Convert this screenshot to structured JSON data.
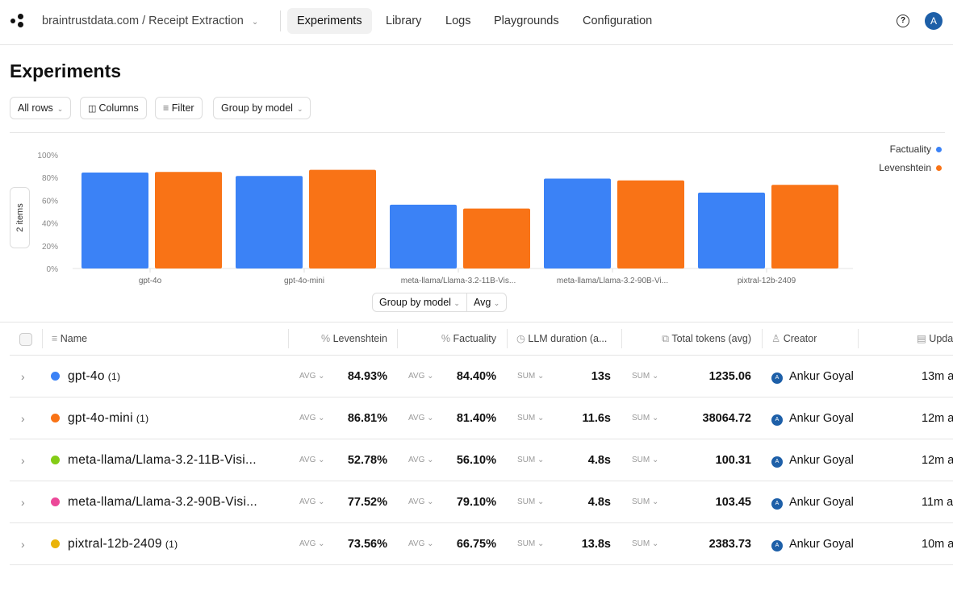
{
  "header": {
    "project": "braintrustdata.com / Receipt Extraction",
    "nav": [
      "Experiments",
      "Library",
      "Logs",
      "Playgrounds",
      "Configuration"
    ],
    "active_nav": "Experiments",
    "avatar": "A"
  },
  "page": {
    "title": "Experiments"
  },
  "toolbar": {
    "all_rows": "All rows",
    "columns": "Columns",
    "filter": "Filter",
    "group_by": "Group by model"
  },
  "chart_controls": {
    "items": "2 items",
    "group_by": "Group by model",
    "agg": "Avg"
  },
  "chart_data": {
    "type": "bar",
    "categories": [
      "gpt-4o",
      "gpt-4o-mini",
      "meta-llama/Llama-3.2-11B-Vis...",
      "meta-llama/Llama-3.2-90B-Vi...",
      "pixtral-12b-2409"
    ],
    "series": [
      {
        "name": "Factuality",
        "color": "#3b82f6",
        "values": [
          84.4,
          81.4,
          56.1,
          79.1,
          66.75
        ]
      },
      {
        "name": "Levenshtein",
        "color": "#f97316",
        "values": [
          84.93,
          86.81,
          52.78,
          77.52,
          73.56
        ]
      }
    ],
    "ylim": [
      0,
      100
    ],
    "yticks": [
      "0%",
      "20%",
      "40%",
      "60%",
      "80%",
      "100%"
    ],
    "legend": "top-right",
    "grid": false
  },
  "table": {
    "columns": [
      "Name",
      "Levenshtein",
      "Factuality",
      "LLM duration (a...",
      "Total tokens (avg)",
      "Creator",
      "Upda"
    ],
    "rows": [
      {
        "name": "gpt-4o",
        "count": "(1)",
        "color": "#3b82f6",
        "lev_agg": "AVG",
        "lev": "84.93%",
        "fact_agg": "AVG",
        "fact": "84.40%",
        "dur_agg": "SUM",
        "dur": "13s",
        "tok_agg": "SUM",
        "tokens": "1235.06",
        "creator": "Ankur Goyal",
        "updated": "13m a"
      },
      {
        "name": "gpt-4o-mini",
        "count": "(1)",
        "color": "#f97316",
        "lev_agg": "AVG",
        "lev": "86.81%",
        "fact_agg": "AVG",
        "fact": "81.40%",
        "dur_agg": "SUM",
        "dur": "11.6s",
        "tok_agg": "SUM",
        "tokens": "38064.72",
        "creator": "Ankur Goyal",
        "updated": "12m a"
      },
      {
        "name": "meta-llama/Llama-3.2-11B-Visi...",
        "count": "",
        "color": "#84cc16",
        "lev_agg": "AVG",
        "lev": "52.78%",
        "fact_agg": "AVG",
        "fact": "56.10%",
        "dur_agg": "SUM",
        "dur": "4.8s",
        "tok_agg": "SUM",
        "tokens": "100.31",
        "creator": "Ankur Goyal",
        "updated": "12m a"
      },
      {
        "name": "meta-llama/Llama-3.2-90B-Visi...",
        "count": "",
        "color": "#ec4899",
        "lev_agg": "AVG",
        "lev": "77.52%",
        "fact_agg": "AVG",
        "fact": "79.10%",
        "dur_agg": "SUM",
        "dur": "4.8s",
        "tok_agg": "SUM",
        "tokens": "103.45",
        "creator": "Ankur Goyal",
        "updated": "11m a"
      },
      {
        "name": "pixtral-12b-2409",
        "count": "(1)",
        "color": "#eab308",
        "lev_agg": "AVG",
        "lev": "73.56%",
        "fact_agg": "AVG",
        "fact": "66.75%",
        "dur_agg": "SUM",
        "dur": "13.8s",
        "tok_agg": "SUM",
        "tokens": "2383.73",
        "creator": "Ankur Goyal",
        "updated": "10m a"
      }
    ]
  }
}
